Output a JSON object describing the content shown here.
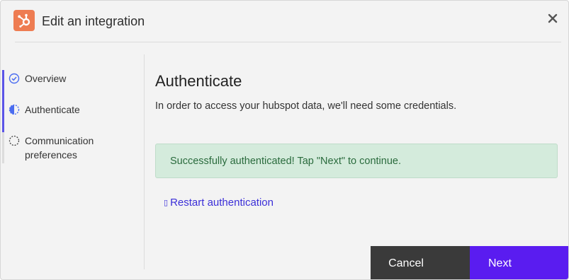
{
  "dialog": {
    "title": "Edit an integration",
    "logo_icon": "hubspot-logo",
    "close_icon": "close-icon",
    "brand_color": "#ee7c52"
  },
  "steps": [
    {
      "label": "Overview",
      "state": "completed",
      "icon": "check-circle-icon"
    },
    {
      "label": "Authenticate",
      "state": "current",
      "icon": "half-circle-icon"
    },
    {
      "label": "Communication preferences",
      "state": "pending",
      "icon": "dashed-circle-icon"
    }
  ],
  "main": {
    "heading": "Authenticate",
    "description": "In order to access your hubspot data, we'll need some credentials.",
    "success_message": "Successfully authenticated! Tap \"Next\" to continue.",
    "restart_glyph": "▯",
    "restart_label": "Restart authentication"
  },
  "footer": {
    "cancel_label": "Cancel",
    "next_label": "Next",
    "accent_color": "#5a1cf0"
  }
}
